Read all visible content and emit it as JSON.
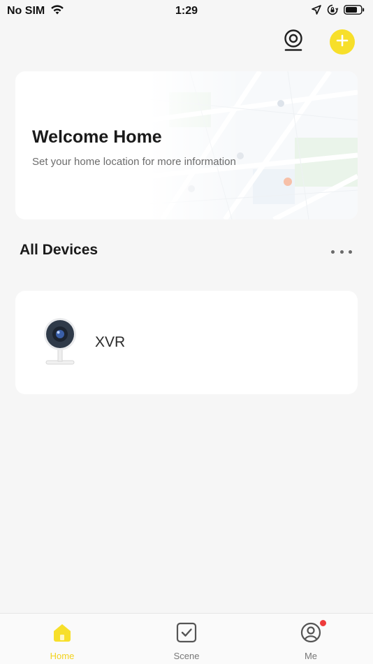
{
  "status_bar": {
    "carrier": "No SIM",
    "time": "1:29",
    "icons": [
      "wifi-icon",
      "location-arrow-icon",
      "orientation-lock-icon",
      "battery-icon"
    ]
  },
  "header": {
    "icons": [
      "camera-icon",
      "add-icon"
    ],
    "accent_color": "#f7df2a"
  },
  "welcome": {
    "title": "Welcome Home",
    "subtitle": "Set your home location for more information"
  },
  "devices": {
    "section_title": "All Devices",
    "items": [
      {
        "name": "XVR",
        "icon": "security-camera-icon"
      }
    ]
  },
  "tabbar": {
    "tabs": [
      {
        "label": "Home",
        "icon": "home-icon",
        "active": true
      },
      {
        "label": "Scene",
        "icon": "checkbox-icon",
        "active": false
      },
      {
        "label": "Me",
        "icon": "profile-icon",
        "active": false,
        "badge": true
      }
    ],
    "active_color": "#f2d21e",
    "badge_color": "#ee3b3b"
  }
}
